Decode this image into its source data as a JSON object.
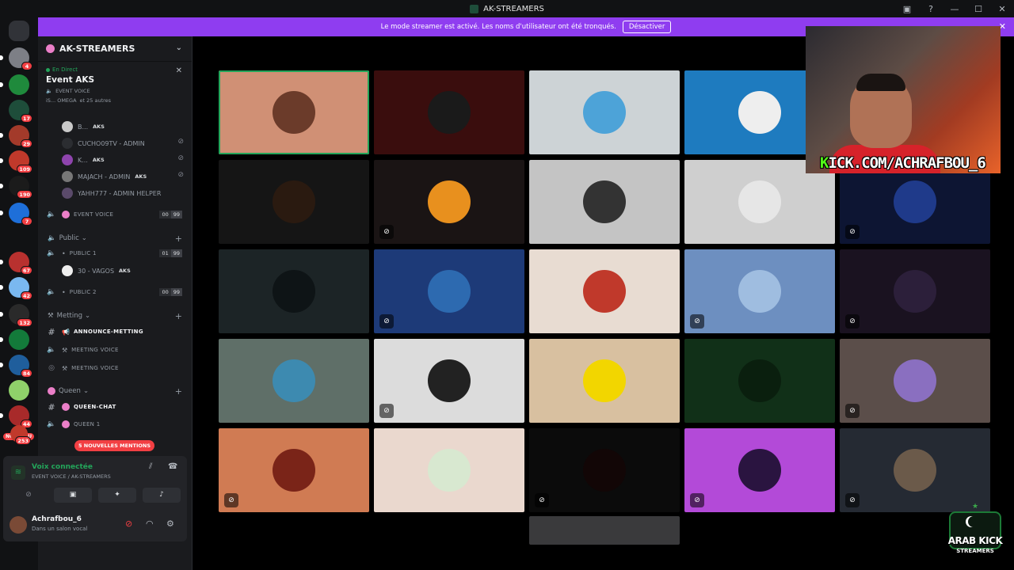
{
  "window": {
    "title": "AK-STREAMERS",
    "controls": [
      "—",
      "☐",
      "✕"
    ]
  },
  "banner": {
    "text": "Le mode streamer est activé. Les noms d'utilisateur ont été tronqués.",
    "button": "Désactiver"
  },
  "servers": {
    "badges": [
      "4",
      "17",
      "29",
      "109",
      "190",
      "7",
      "67",
      "42",
      "132",
      "84",
      "44",
      "253"
    ],
    "new_label": "NOUVEAU"
  },
  "guild": {
    "name": "AK-STREAMERS"
  },
  "event": {
    "live": "En Direct",
    "title": "Event AKS",
    "channel": "EVENT VOICE",
    "participants": "iS... OMEGA",
    "others": "et 25 autres"
  },
  "event_users": [
    {
      "name": "B...",
      "tag": "AKS"
    },
    {
      "name": "CUCHO09TV - ADMIN",
      "tag": ""
    },
    {
      "name": "K...",
      "tag": "AKS"
    },
    {
      "name": "MAJACH - ADMIN",
      "tag": "AKS"
    },
    {
      "name": "YAHH777 - ADMIN HELPER",
      "tag": ""
    }
  ],
  "channels": {
    "event_voice": {
      "name": "EVENT VOICE",
      "count": "00",
      "limit": "99"
    },
    "public_cat": "Public",
    "public1": {
      "name": "PUBLIC 1",
      "count": "01",
      "limit": "99"
    },
    "public1_user": {
      "name": "30 - VAGOS",
      "tag": "AKS"
    },
    "public2": {
      "name": "PUBLIC 2",
      "count": "00",
      "limit": "99"
    },
    "metting_cat": "Metting",
    "announce": "ANNOUNCE-METTING",
    "meeting_voice1": "MEETING VOICE",
    "meeting_voice2": "MEETING VOICE",
    "queen_cat": "Queen",
    "queen_chat": "QUEEN-CHAT",
    "queen1": "QUEEN 1"
  },
  "mentions": "5 NOUVELLES MENTIONS",
  "voice_panel": {
    "title": "Voix connectée",
    "subtitle": "EVENT VOICE / AK-STREAMERS"
  },
  "user_panel": {
    "name": "Achrafbou_6",
    "status": "Dans un salon vocal"
  },
  "webcam": {
    "kick_k": "K",
    "kick_rest": "ICK.COM/ACHRAFBOU_6"
  },
  "logo": {
    "line1": "ARAB KICK",
    "line2": "STREAMERS"
  },
  "colors": {
    "accent": "#8f3df0",
    "live": "#23a55a",
    "mention": "#f23f43",
    "kick": "#53fc18"
  }
}
